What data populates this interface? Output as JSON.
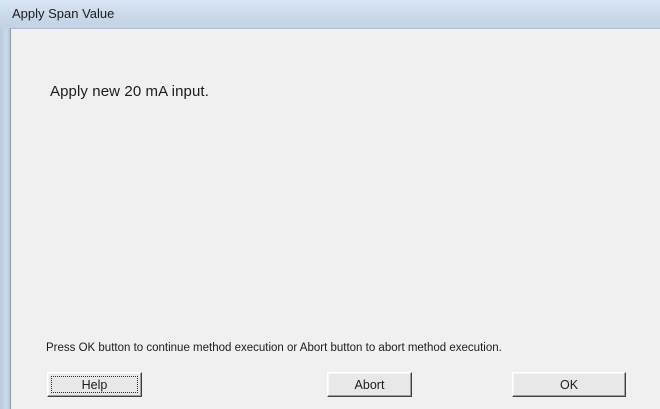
{
  "window": {
    "title": "Apply Span Value"
  },
  "dialog": {
    "message": "Apply new 20 mA input.",
    "instruction": "Press OK button to continue method execution or Abort button to abort method execution."
  },
  "buttons": {
    "help_label": "Help",
    "abort_label": "Abort",
    "ok_label": "OK"
  }
}
